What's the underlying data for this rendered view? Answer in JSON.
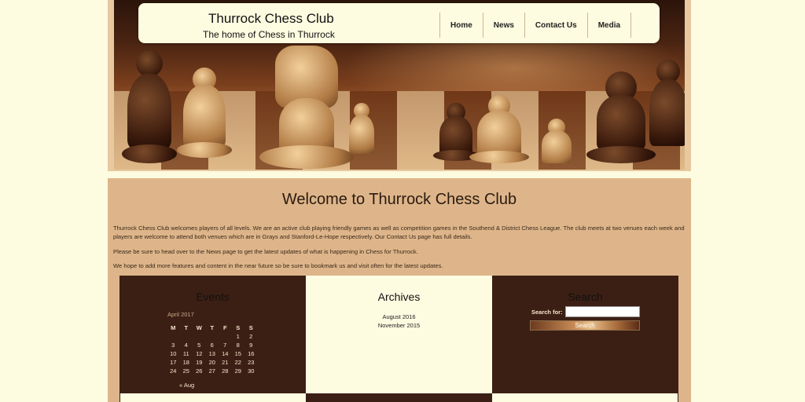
{
  "site": {
    "title": "Thurrock Chess Club",
    "tagline": "The home of Chess in Thurrock"
  },
  "nav": {
    "items": [
      "Home",
      "News",
      "Contact Us",
      "Media"
    ]
  },
  "main": {
    "heading": "Welcome to Thurrock Chess Club",
    "paragraphs": [
      "Thurrock Chess Club welcomes players of all levels. We are an active club playing friendly games as well as competition games in the Southend & District Chess League. The club meets at two venues each week and players are welcome to attend both venues which are in Grays and Stanford-Le-Hope respectively. Our Contact Us page has full details.",
      "Please be sure to head over to the News page to get the latest updates of what is happening in Chess for Thurrock.",
      "We hope to add more features and content in the near future so be sure to bookmark us and visit often for the latest updates."
    ]
  },
  "events": {
    "title": "Events",
    "caption": "April 2017",
    "weekdays": [
      "M",
      "T",
      "W",
      "T",
      "F",
      "S",
      "S"
    ],
    "weeks": [
      [
        "",
        "",
        "",
        "",
        "",
        "1",
        "2"
      ],
      [
        "3",
        "4",
        "5",
        "6",
        "7",
        "8",
        "9"
      ],
      [
        "10",
        "11",
        "12",
        "13",
        "14",
        "15",
        "16"
      ],
      [
        "17",
        "18",
        "19",
        "20",
        "21",
        "22",
        "23"
      ],
      [
        "24",
        "25",
        "26",
        "27",
        "28",
        "29",
        "30"
      ]
    ],
    "prev_link": "« Aug"
  },
  "archives": {
    "title": "Archives",
    "items": [
      "August 2016",
      "November 2015"
    ]
  },
  "search": {
    "title": "Search",
    "label": "Search for:",
    "value": "",
    "button": "Search"
  },
  "colors": {
    "page_bg": "#fdfbe0",
    "panel_bg": "#deb58a",
    "widget_dark": "#3c1f14",
    "widget_light": "#fdfbe0"
  }
}
